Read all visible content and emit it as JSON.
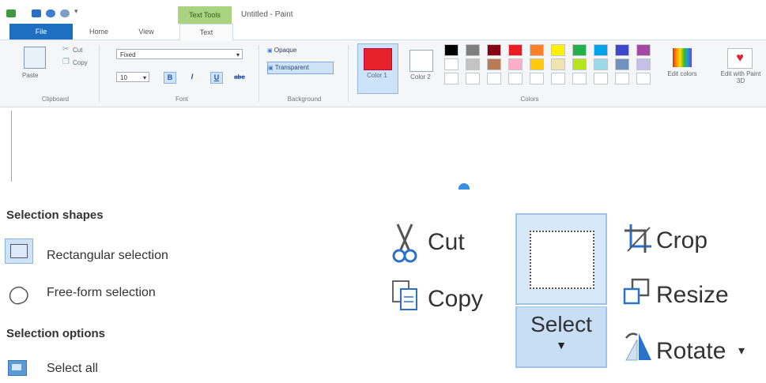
{
  "paint": {
    "title": "Untitled - Paint",
    "contextual_tab_label": "Text Tools",
    "tabs": [
      "File",
      "Home",
      "View",
      "Text"
    ],
    "clipboard": {
      "paste": "Paste",
      "cut": "Cut",
      "copy": "Copy",
      "group_label": "Clipboard"
    },
    "font": {
      "name": "Fixed",
      "size": "10",
      "bold": "B",
      "italic": "I",
      "underline": "U",
      "strike": "abc",
      "group_label": "Font"
    },
    "background": {
      "opaque": "Opaque",
      "transparent": "Transparent",
      "group_label": "Background"
    },
    "colors": {
      "color1_label": "Color 1",
      "color2_label": "Color 2",
      "edit_colors": "Edit colors",
      "edit_paint3d": "Edit with Paint 3D",
      "group_label": "Colors",
      "color1": "#e8222a",
      "color2": "#ffffff",
      "palette_row1": [
        "#000000",
        "#7f7f7f",
        "#880015",
        "#ed1c24",
        "#ff7f27",
        "#fff200",
        "#22b14c",
        "#00a2e8",
        "#3f48cc",
        "#a349a4"
      ],
      "palette_row2": [
        "#ffffff",
        "#c3c3c3",
        "#b97a57",
        "#ffaec9",
        "#ffc90e",
        "#efe4b0",
        "#b5e61d",
        "#99d9ea",
        "#7092be",
        "#c8bfe7"
      ]
    }
  },
  "selection_menu": {
    "heading_shapes": "Selection shapes",
    "rect_selection": "Rectangular selection",
    "freeform_selection": "Free-form selection",
    "heading_options": "Selection options",
    "select_all": "Select all"
  },
  "ribbon_zoom": {
    "cut": "Cut",
    "copy": "Copy",
    "select": "Select",
    "crop": "Crop",
    "resize": "Resize",
    "rotate": "Rotate"
  }
}
